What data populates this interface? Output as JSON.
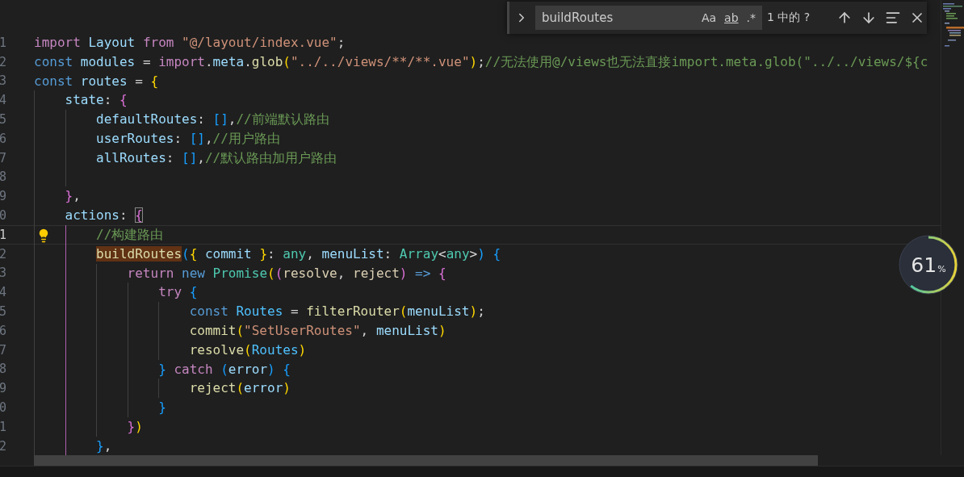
{
  "editor": {
    "lines": [
      {
        "number": "1",
        "current": false,
        "active_guide": false,
        "tokens": [
          {
            "text": "import",
            "kind": "keyword"
          },
          {
            "text": " Layout",
            "kind": "variable"
          },
          {
            "text": " from",
            "kind": "keyword"
          },
          {
            "text": " \"@/layout/index.vue\"",
            "kind": "string"
          },
          {
            "text": ";",
            "kind": "plain"
          }
        ]
      },
      {
        "number": "2",
        "current": false,
        "active_guide": false,
        "tokens": [
          {
            "text": "const",
            "kind": "storage"
          },
          {
            "text": " modules",
            "kind": "variable"
          },
          {
            "text": " =",
            "kind": "plain"
          },
          {
            "text": " import",
            "kind": "keyword"
          },
          {
            "text": ".",
            "kind": "plain"
          },
          {
            "text": "meta",
            "kind": "variable"
          },
          {
            "text": ".",
            "kind": "plain"
          },
          {
            "text": "glob",
            "kind": "function"
          },
          {
            "text": "(",
            "kind": "bracket1"
          },
          {
            "text": "\"../../views/**/**.vue\"",
            "kind": "string"
          },
          {
            "text": ")",
            "kind": "bracket1"
          },
          {
            "text": ";",
            "kind": "plain"
          },
          {
            "text": "//无法使用@/views也无法直接import.meta.glob(\"../../views/${c",
            "kind": "comment"
          }
        ]
      },
      {
        "number": "3",
        "current": false,
        "active_guide": false,
        "tokens": [
          {
            "text": "const",
            "kind": "storage"
          },
          {
            "text": " routes",
            "kind": "variable"
          },
          {
            "text": " =",
            "kind": "plain"
          },
          {
            "text": " {",
            "kind": "bracket1"
          }
        ]
      },
      {
        "number": "4",
        "current": false,
        "active_guide": false,
        "tokens": [
          {
            "text": "    state",
            "kind": "variable"
          },
          {
            "text": ":",
            "kind": "plain"
          },
          {
            "text": " {",
            "kind": "bracket2"
          }
        ]
      },
      {
        "number": "5",
        "current": false,
        "active_guide": false,
        "tokens": [
          {
            "text": "        defaultRoutes",
            "kind": "variable"
          },
          {
            "text": ":",
            "kind": "plain"
          },
          {
            "text": " []",
            "kind": "bracket3"
          },
          {
            "text": ",",
            "kind": "plain"
          },
          {
            "text": "//前端默认路由",
            "kind": "comment"
          }
        ]
      },
      {
        "number": "6",
        "current": false,
        "active_guide": false,
        "tokens": [
          {
            "text": "        userRoutes",
            "kind": "variable"
          },
          {
            "text": ":",
            "kind": "plain"
          },
          {
            "text": " []",
            "kind": "bracket3"
          },
          {
            "text": ",",
            "kind": "plain"
          },
          {
            "text": "//用户路由",
            "kind": "comment"
          }
        ]
      },
      {
        "number": "7",
        "current": false,
        "active_guide": false,
        "tokens": [
          {
            "text": "        allRoutes",
            "kind": "variable"
          },
          {
            "text": ":",
            "kind": "plain"
          },
          {
            "text": " []",
            "kind": "bracket3"
          },
          {
            "text": ",",
            "kind": "plain"
          },
          {
            "text": "//默认路由加用户路由",
            "kind": "comment"
          }
        ]
      },
      {
        "number": "8",
        "current": false,
        "active_guide": false
      },
      {
        "number": "9",
        "current": false,
        "active_guide": false,
        "tokens": [
          {
            "text": "    }",
            "kind": "bracket2"
          },
          {
            "text": ",",
            "kind": "plain"
          }
        ]
      },
      {
        "number": "0",
        "current": false,
        "active_guide": false,
        "tokens": [
          {
            "text": "    actions",
            "kind": "variable"
          },
          {
            "text": ": ",
            "kind": "plain"
          },
          {
            "text": "{",
            "kind": "bracket-match"
          }
        ]
      },
      {
        "number": "1",
        "current": true,
        "active_guide": true,
        "tokens": [
          {
            "text": "        //构建路由",
            "kind": "comment"
          }
        ]
      },
      {
        "number": "2",
        "current": false,
        "active_guide": true,
        "tokens": [
          {
            "text": "        buildRoutes",
            "kind": "find-match"
          },
          {
            "text": "(",
            "kind": "bracket3"
          },
          {
            "text": "{",
            "kind": "bracket1"
          },
          {
            "text": " commit",
            "kind": "variable"
          },
          {
            "text": " }",
            "kind": "bracket1"
          },
          {
            "text": ":",
            "kind": "plain"
          },
          {
            "text": " any",
            "kind": "type"
          },
          {
            "text": ",",
            "kind": "plain"
          },
          {
            "text": " menuList",
            "kind": "variable"
          },
          {
            "text": ":",
            "kind": "plain"
          },
          {
            "text": " Array",
            "kind": "type"
          },
          {
            "text": "<",
            "kind": "plain"
          },
          {
            "text": "any",
            "kind": "type"
          },
          {
            "text": ">",
            "kind": "plain"
          },
          {
            "text": ")",
            "kind": "bracket3"
          },
          {
            "text": " {",
            "kind": "bracket3"
          }
        ]
      },
      {
        "number": "3",
        "current": false,
        "active_guide": true,
        "tokens": [
          {
            "text": "            return",
            "kind": "keyword"
          },
          {
            "text": " new",
            "kind": "storage"
          },
          {
            "text": " Promise",
            "kind": "type"
          },
          {
            "text": "(",
            "kind": "bracket1"
          },
          {
            "text": "(",
            "kind": "bracket2"
          },
          {
            "text": "resolve",
            "kind": "parameter"
          },
          {
            "text": ",",
            "kind": "plain"
          },
          {
            "text": " reject",
            "kind": "parameter"
          },
          {
            "text": ")",
            "kind": "bracket2"
          },
          {
            "text": " =>",
            "kind": "storage"
          },
          {
            "text": " {",
            "kind": "bracket2"
          }
        ]
      },
      {
        "number": "4",
        "current": false,
        "active_guide": true,
        "tokens": [
          {
            "text": "                try",
            "kind": "keyword"
          },
          {
            "text": " {",
            "kind": "bracket3"
          }
        ]
      },
      {
        "number": "5",
        "current": false,
        "active_guide": true,
        "tokens": [
          {
            "text": "                    const",
            "kind": "storage"
          },
          {
            "text": " Routes",
            "kind": "constant"
          },
          {
            "text": " =",
            "kind": "plain"
          },
          {
            "text": " filterRouter",
            "kind": "function"
          },
          {
            "text": "(",
            "kind": "bracket1"
          },
          {
            "text": "menuList",
            "kind": "variable"
          },
          {
            "text": ")",
            "kind": "bracket1"
          },
          {
            "text": ";",
            "kind": "plain"
          }
        ]
      },
      {
        "number": "6",
        "current": false,
        "active_guide": true,
        "tokens": [
          {
            "text": "                    commit",
            "kind": "function"
          },
          {
            "text": "(",
            "kind": "bracket1"
          },
          {
            "text": "\"SetUserRoutes\"",
            "kind": "string"
          },
          {
            "text": ",",
            "kind": "plain"
          },
          {
            "text": " menuList",
            "kind": "variable"
          },
          {
            "text": ")",
            "kind": "bracket1"
          }
        ]
      },
      {
        "number": "7",
        "current": false,
        "active_guide": true,
        "tokens": [
          {
            "text": "                    resolve",
            "kind": "function"
          },
          {
            "text": "(",
            "kind": "bracket1"
          },
          {
            "text": "Routes",
            "kind": "constant"
          },
          {
            "text": ")",
            "kind": "bracket1"
          }
        ]
      },
      {
        "number": "8",
        "current": false,
        "active_guide": true,
        "tokens": [
          {
            "text": "                }",
            "kind": "bracket3"
          },
          {
            "text": " catch",
            "kind": "keyword"
          },
          {
            "text": " (",
            "kind": "bracket3"
          },
          {
            "text": "error",
            "kind": "variable"
          },
          {
            "text": ")",
            "kind": "bracket3"
          },
          {
            "text": " {",
            "kind": "bracket3"
          }
        ]
      },
      {
        "number": "9",
        "current": false,
        "active_guide": true,
        "tokens": [
          {
            "text": "                    reject",
            "kind": "function"
          },
          {
            "text": "(",
            "kind": "bracket1"
          },
          {
            "text": "error",
            "kind": "variable"
          },
          {
            "text": ")",
            "kind": "bracket1"
          }
        ]
      },
      {
        "number": "0",
        "current": false,
        "active_guide": true,
        "tokens": [
          {
            "text": "                }",
            "kind": "bracket3"
          }
        ]
      },
      {
        "number": "1",
        "current": false,
        "active_guide": true,
        "tokens": [
          {
            "text": "            }",
            "kind": "bracket2"
          },
          {
            "text": ")",
            "kind": "bracket1"
          }
        ]
      },
      {
        "number": "2",
        "current": false,
        "active_guide": true,
        "tokens": [
          {
            "text": "        }",
            "kind": "bracket3"
          },
          {
            "text": ",",
            "kind": "plain"
          }
        ]
      }
    ]
  },
  "find_widget": {
    "value": "buildRoutes",
    "match_case": "Aa",
    "whole_word": "ab",
    "regex": ".*",
    "result": "1 中的 ?"
  },
  "meter": {
    "reading": "61",
    "unit": "%",
    "level": 0.61
  }
}
